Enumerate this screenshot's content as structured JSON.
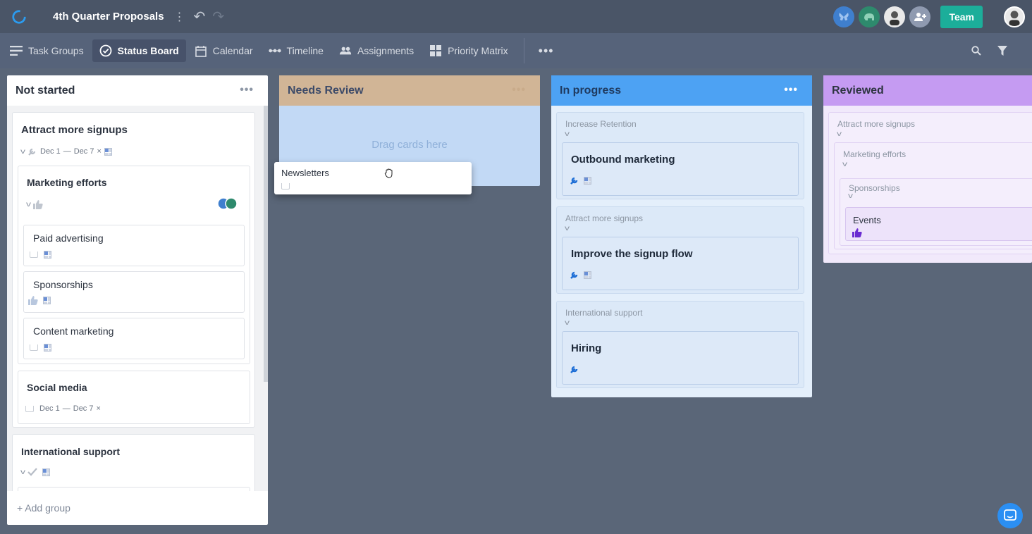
{
  "header": {
    "project_title": "4th Quarter Proposals",
    "team_label": "Team"
  },
  "views": [
    {
      "label": "Task Groups",
      "icon": "list-icon"
    },
    {
      "label": "Status Board",
      "icon": "check-circle-icon",
      "active": true
    },
    {
      "label": "Calendar",
      "icon": "calendar-icon"
    },
    {
      "label": "Timeline",
      "icon": "timeline-icon"
    },
    {
      "label": "Assignments",
      "icon": "people-icon"
    },
    {
      "label": "Priority Matrix",
      "icon": "grid-icon"
    }
  ],
  "columns": {
    "not_started": {
      "title": "Not started",
      "add_group": "+ Add group",
      "color": "#ffffff"
    },
    "needs_review": {
      "title": "Needs Review",
      "drop_hint": "Drag cards here",
      "color": "#d1b596"
    },
    "in_progress": {
      "title": "In progress",
      "color": "#4da2f3"
    },
    "reviewed": {
      "title": "Reviewed",
      "color": "#c59bf2"
    }
  },
  "not_started_cards": {
    "g1_title": "Attract more signups",
    "g1_dates_start": "Dec 1",
    "g1_dates_end": "Dec 7",
    "marketing_title": "Marketing efforts",
    "paid": "Paid advertising",
    "sponsorships": "Sponsorships",
    "content": "Content marketing",
    "social_title": "Social media",
    "social_start": "Dec 1",
    "social_end": "Dec 7",
    "g2_title": "International support"
  },
  "dragging_card": {
    "title": "Newsletters"
  },
  "in_progress_cards": [
    {
      "group": "Increase Retention",
      "title": "Outbound marketing"
    },
    {
      "group": "Attract more signups",
      "title": "Improve the signup flow"
    },
    {
      "group": "International support",
      "title": "Hiring"
    }
  ],
  "reviewed_cards": {
    "l1": "Attract more signups",
    "l2": "Marketing efforts",
    "l3": "Sponsorships",
    "leaf": "Events"
  },
  "colors": {
    "accent_team": "#1cae9a",
    "topbar": "#4a5567",
    "background": "#5a6678"
  }
}
